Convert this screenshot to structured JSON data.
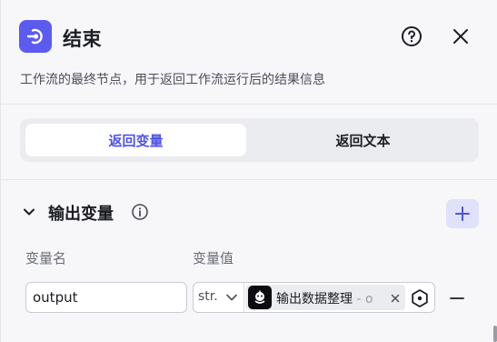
{
  "header": {
    "title": "结束",
    "icon": "end-node-icon",
    "help_icon": "question-circle-icon",
    "close_icon": "close-icon"
  },
  "description": "工作流的最终节点，用于返回工作流运行后的结果信息",
  "tabs": [
    {
      "label": "返回变量",
      "active": true
    },
    {
      "label": "返回文本",
      "active": false
    }
  ],
  "output_section": {
    "title": "输出变量",
    "info_icon": "info-circle-icon",
    "add_icon": "plus-icon",
    "column_headers": [
      "变量名",
      "变量值"
    ],
    "rows": [
      {
        "name": "output",
        "type": "str.",
        "ref_label": "输出数据整理",
        "ref_suffix": " - o",
        "ref_icon": "plugin-avatar-icon"
      }
    ]
  },
  "colors": {
    "accent": "#4d53e8",
    "node_icon_bg": "#5b5bf0",
    "add_button_bg": "#e0e1fb"
  }
}
